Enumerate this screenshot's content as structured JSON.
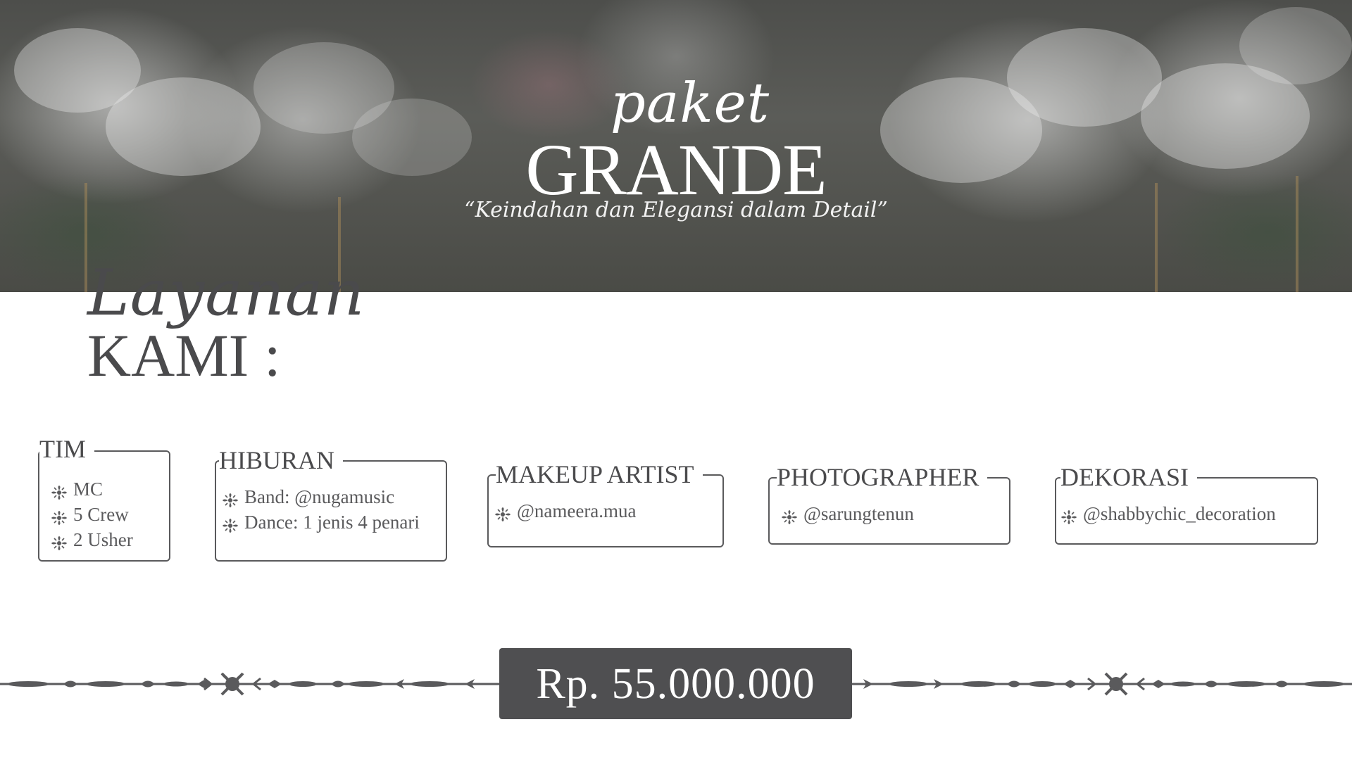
{
  "hero": {
    "script_title": "paket",
    "main_title": "GRANDE",
    "tagline": "“Keindahan dan Elegansi dalam Detail”"
  },
  "section": {
    "script_title": "Layanan",
    "main_title": "KAMI :"
  },
  "services": [
    {
      "title": "TIM",
      "items": [
        "MC",
        "5 Crew",
        "2 Usher"
      ]
    },
    {
      "title": "HIBURAN",
      "items": [
        "Band: @nugamusic",
        "Dance: 1 jenis 4 penari"
      ]
    },
    {
      "title": "MAKEUP ARTIST",
      "items": [
        "@nameera.mua"
      ]
    },
    {
      "title": "PHOTOGRAPHER",
      "items": [
        "@sarungtenun"
      ]
    },
    {
      "title": "DEKORASI",
      "items": [
        "@shabbychic_decoration"
      ]
    }
  ],
  "price": "Rp. 55.000.000",
  "icons": {
    "bullet": "fleur-ornament-icon",
    "divider": "scroll-ornament-divider"
  },
  "colors": {
    "text": "#4a4a4c",
    "price_bg": "#4f4f51",
    "hero_overlay": "#4d4e4b"
  }
}
